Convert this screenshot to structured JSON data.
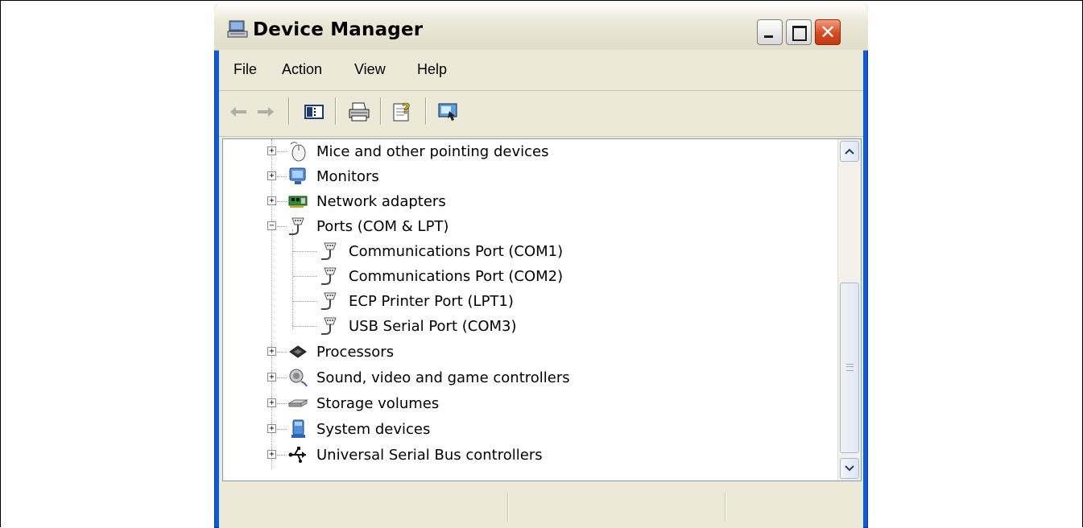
{
  "window": {
    "title": "Device Manager",
    "colors": {
      "titlebar": "#0a5fd8",
      "close": "#d64a1f",
      "face": "#ece9d8"
    }
  },
  "menu": [
    "File",
    "Action",
    "View",
    "Help"
  ],
  "toolbar": {
    "icons": [
      "back-arrow-icon",
      "forward-arrow-icon",
      "show-hide-console-tree-icon",
      "print-icon",
      "properties-help-icon",
      "update-driver-icon"
    ]
  },
  "tree": {
    "items": [
      {
        "label": "Mice and other pointing devices",
        "icon": "mouse-icon",
        "expanded": false
      },
      {
        "label": "Monitors",
        "icon": "monitor-icon",
        "expanded": false
      },
      {
        "label": "Network adapters",
        "icon": "network-card-icon",
        "expanded": false
      },
      {
        "label": "Ports (COM & LPT)",
        "icon": "port-icon",
        "expanded": true
      },
      {
        "label": "Communications Port (COM1)",
        "icon": "port-icon",
        "child": true
      },
      {
        "label": "Communications Port (COM2)",
        "icon": "port-icon",
        "child": true
      },
      {
        "label": "ECP Printer Port (LPT1)",
        "icon": "port-icon",
        "child": true
      },
      {
        "label": "USB Serial Port (COM3)",
        "icon": "port-icon",
        "child": true
      },
      {
        "label": "Processors",
        "icon": "cpu-icon",
        "expanded": false
      },
      {
        "label": "Sound, video and game controllers",
        "icon": "speaker-icon",
        "expanded": false
      },
      {
        "label": "Storage volumes",
        "icon": "disk-icon",
        "expanded": false
      },
      {
        "label": "System devices",
        "icon": "system-device-icon",
        "expanded": false
      },
      {
        "label": "Universal Serial Bus controllers",
        "icon": "usb-icon",
        "expanded": false
      }
    ]
  }
}
